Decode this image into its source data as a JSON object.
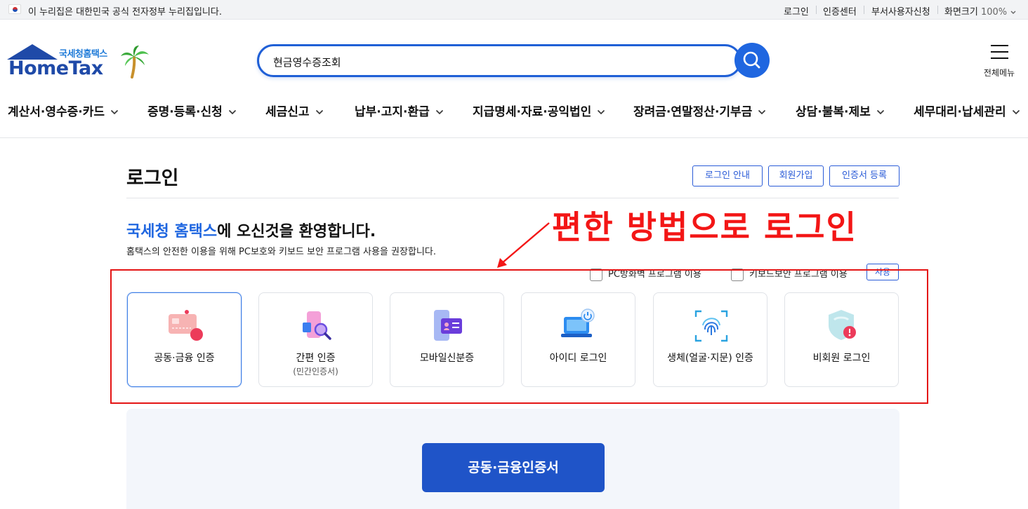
{
  "gov_banner": {
    "text": "이 누리집은 대한민국 공식 전자정부 누리집입니다.",
    "links": [
      "로그인",
      "인증센터",
      "부서사용자신청"
    ],
    "zoom_label": "화면크기",
    "zoom_value": "100%"
  },
  "header": {
    "logo_sub": "국세청홈택스",
    "logo_main": "HomeTax",
    "search_value": "현금영수증조회",
    "menu_label": "전체메뉴"
  },
  "gnb": [
    "계산서·영수증·카드",
    "증명·등록·신청",
    "세금신고",
    "납부·고지·환급",
    "지급명세·자료·공익법인",
    "장려금·연말정산·기부금",
    "상담·불복·제보",
    "세무대리·납세관리"
  ],
  "login": {
    "title": "로그인",
    "buttons": [
      "로그인 안내",
      "회원가입",
      "인증서 등록"
    ],
    "welcome_brand": "국세청 홈택스",
    "welcome_rest": "에 오신것을 환영합니다.",
    "welcome_sub": "홈택스의 안전한 이용을 위해 PC보호와 키보드 보안 프로그램 사용을 권장합니다.",
    "options": [
      "PC방화벽 프로그램 이용",
      "키보드보안 프로그램 이용"
    ],
    "use_button": "사용",
    "methods": [
      {
        "label": "공동·금융 인증",
        "sub": "",
        "icon": "certificate-card-icon"
      },
      {
        "label": "간편 인증",
        "sub": "(민간인증서)",
        "icon": "phone-search-icon"
      },
      {
        "label": "모바일신분증",
        "sub": "",
        "icon": "mobile-id-icon"
      },
      {
        "label": "아이디 로그인",
        "sub": "",
        "icon": "laptop-power-icon"
      },
      {
        "label": "생체(얼굴·지문) 인증",
        "sub": "",
        "icon": "fingerprint-icon"
      },
      {
        "label": "비회원 로그인",
        "sub": "",
        "icon": "shield-user-icon"
      }
    ],
    "primary_button": "공동·금융인증서"
  },
  "annotation": {
    "text": "편한 방법으로 로그인",
    "color": "#f31616"
  },
  "colors": {
    "brand_blue": "#1f66e0",
    "button_blue": "#1f54c8"
  }
}
